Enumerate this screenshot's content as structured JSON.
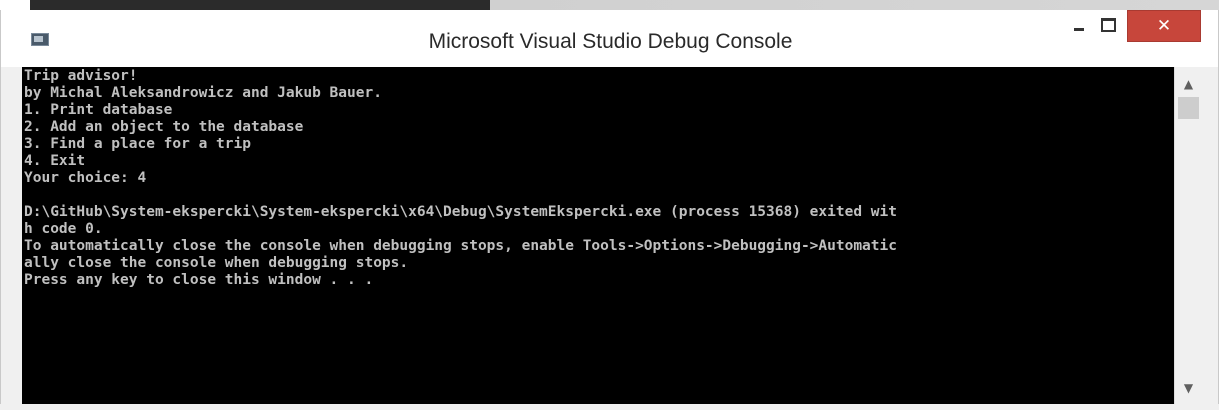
{
  "window": {
    "title": "Microsoft Visual Studio Debug Console",
    "close_glyph": "✕",
    "icon": "console-app-icon"
  },
  "console": {
    "lines": [
      "Trip advisor!",
      "by Michal Aleksandrowicz and Jakub Bauer.",
      "1. Print database",
      "2. Add an object to the database",
      "3. Find a place for a trip",
      "4. Exit",
      "Your choice: 4",
      "",
      "D:\\GitHub\\System-ekspercki\\System-ekspercki\\x64\\Debug\\SystemEkspercki.exe (process 15368) exited wit",
      "h code 0.",
      "To automatically close the console when debugging stops, enable Tools->Options->Debugging->Automatic",
      "ally close the console when debugging stops.",
      "Press any key to close this window . . ."
    ],
    "text_color": "#c0c0c0",
    "background_color": "#000000"
  },
  "scrollbar": {
    "up_glyph": "▲",
    "down_glyph": "▼"
  },
  "colors": {
    "close_button": "#c7463b"
  }
}
